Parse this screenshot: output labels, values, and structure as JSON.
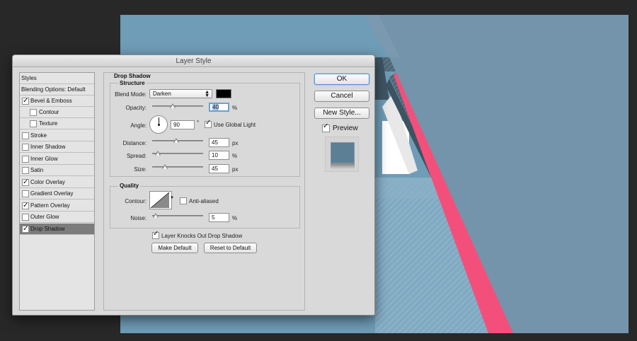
{
  "dialog": {
    "title": "Layer Style"
  },
  "styles_list": {
    "items": [
      {
        "label": "Styles",
        "check": null,
        "selected": false
      },
      {
        "label": "Blending Options: Default",
        "check": null,
        "selected": false
      },
      {
        "label": "Bevel & Emboss",
        "check": true,
        "selected": false
      },
      {
        "label": "Contour",
        "check": false,
        "selected": false
      },
      {
        "label": "Texture",
        "check": false,
        "selected": false
      },
      {
        "label": "Stroke",
        "check": false,
        "selected": false
      },
      {
        "label": "Inner Shadow",
        "check": false,
        "selected": false
      },
      {
        "label": "Inner Glow",
        "check": false,
        "selected": false
      },
      {
        "label": "Satin",
        "check": false,
        "selected": false
      },
      {
        "label": "Color Overlay",
        "check": true,
        "selected": false
      },
      {
        "label": "Gradient Overlay",
        "check": false,
        "selected": false
      },
      {
        "label": "Pattern Overlay",
        "check": true,
        "selected": false
      },
      {
        "label": "Outer Glow",
        "check": false,
        "selected": false
      },
      {
        "label": "Drop Shadow",
        "check": true,
        "selected": true
      }
    ]
  },
  "drop_shadow": {
    "title": "Drop Shadow",
    "structure": {
      "title": "Structure",
      "blend_mode_label": "Blend Mode:",
      "blend_mode_value": "Darken",
      "shadow_color": "#000000",
      "opacity_label": "Opacity:",
      "opacity_value": "40",
      "opacity_unit": "%",
      "opacity_slider": 0.4,
      "angle_label": "Angle:",
      "angle_value": "90",
      "angle_unit": "°",
      "use_global_light_label": "Use Global Light",
      "use_global_light": true,
      "distance_label": "Distance:",
      "distance_value": "45",
      "distance_unit": "px",
      "distance_slider": 0.45,
      "spread_label": "Spread:",
      "spread_value": "10",
      "spread_unit": "%",
      "spread_slider": 0.1,
      "size_label": "Size:",
      "size_value": "45",
      "size_unit": "px",
      "size_slider": 0.25
    },
    "quality": {
      "title": "Quality",
      "contour_label": "Contour:",
      "anti_aliased_label": "Anti-aliased",
      "anti_aliased": false,
      "noise_label": "Noise:",
      "noise_value": "5",
      "noise_unit": "%",
      "noise_slider": 0.05
    },
    "knockout_label": "Layer Knocks Out Drop Shadow",
    "knockout": true,
    "make_default_label": "Make Default",
    "reset_default_label": "Reset to Default"
  },
  "buttons": {
    "ok": "OK",
    "cancel": "Cancel",
    "new_style": "New Style...",
    "preview_label": "Preview",
    "preview_checked": true
  },
  "colors": {
    "canvas_blue": "#6f9cb6",
    "slate": "#7494ab",
    "pink_stripe": "#f2507a",
    "selection": "#7c7c7c"
  }
}
